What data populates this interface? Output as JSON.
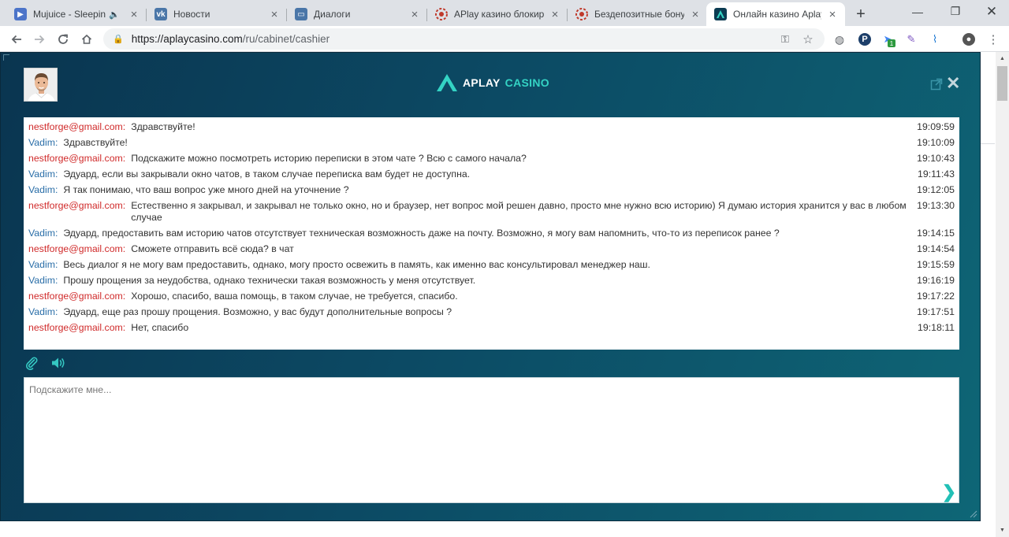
{
  "browser": {
    "tabs": [
      {
        "title": "Mujuice - Sleeping",
        "favicon": "play-icon",
        "favicon_color": "#4c74c9",
        "audio": true
      },
      {
        "title": "Новости",
        "favicon": "vk-icon",
        "favicon_color": "#4a76a8"
      },
      {
        "title": "Диалоги",
        "favicon": "chat-icon",
        "favicon_color": "#4a76a8"
      },
      {
        "title": "APlay казино блокиру",
        "favicon": "chip-icon",
        "favicon_color": "#c0392b"
      },
      {
        "title": "Бездепозитные бонус",
        "favicon": "chip-icon",
        "favicon_color": "#c0392b"
      },
      {
        "title": "Онлайн казино Aplay",
        "favicon": "aplay-icon",
        "favicon_color": "#0b3b52",
        "active": true
      }
    ],
    "new_tab_label": "+",
    "url_host": "https://aplaycasino.com",
    "url_path": "/ru/cabinet/cashier"
  },
  "chat": {
    "brand_part1": "APLAY",
    "brand_part2": "CASINO",
    "brand_accent": "#34d3c4",
    "client_color": "#d02a2a",
    "agent_color": "#2a6ea8",
    "messages": [
      {
        "author": "nestforge@gmail.com:",
        "role": "client",
        "text": "Здравствуйте!",
        "time": "19:09:59"
      },
      {
        "author": "Vadim:",
        "role": "agent",
        "text": "Здравствуйте!",
        "time": "19:10:09"
      },
      {
        "author": "nestforge@gmail.com:",
        "role": "client",
        "text": "Подскажите можно посмотреть историю переписки в этом чате ? Всю с самого начала?",
        "time": "19:10:43"
      },
      {
        "author": "Vadim:",
        "role": "agent",
        "text": "Эдуард, если вы закрывали окно чатов, в таком случае переписка вам будет не доступна.",
        "time": "19:11:43"
      },
      {
        "author": "Vadim:",
        "role": "agent",
        "text": "Я так понимаю, что ваш вопрос уже много дней на уточнение ?",
        "time": "19:12:05"
      },
      {
        "author": "nestforge@gmail.com:",
        "role": "client",
        "text": "Естественно я закрывал, и закрывал не только окно, но и браузер, нет вопрос мой решен давно, просто мне нужно всю историю) Я думаю история хранится у вас в любом случае",
        "time": "19:13:30"
      },
      {
        "author": "Vadim:",
        "role": "agent",
        "text": "Эдуард, предоставить вам историю чатов отсутствует техническая возможность даже на почту. Возможно, я могу вам напомнить, что-то из переписок ранее ?",
        "time": "19:14:15"
      },
      {
        "author": "nestforge@gmail.com:",
        "role": "client",
        "text": "Сможете отправить всё сюда? в чат",
        "time": "19:14:54"
      },
      {
        "author": "Vadim:",
        "role": "agent",
        "text": "Весь диалог я не могу вам предоставить, однако, могу просто освежить в память, как именно вас консультировал менеджер наш.",
        "time": "19:15:59"
      },
      {
        "author": "Vadim:",
        "role": "agent",
        "text": "Прошу прощения за неудобства, однако технически такая возможность у меня отсутствует.",
        "time": "19:16:19"
      },
      {
        "author": "nestforge@gmail.com:",
        "role": "client",
        "text": "Хорошо, спасибо, ваша помощь, в таком случае, не требуется, спасибо.",
        "time": "19:17:22"
      },
      {
        "author": "Vadim:",
        "role": "agent",
        "text": "Эдуард, еще раз прошу прощения. Возможно, у вас будут дополнительные вопросы ?",
        "time": "19:17:51"
      },
      {
        "author": "nestforge@gmail.com:",
        "role": "client",
        "text": "Нет, спасибо",
        "time": "19:18:11"
      }
    ],
    "input_placeholder": "Подскажите мне...",
    "send_label": "❯"
  }
}
